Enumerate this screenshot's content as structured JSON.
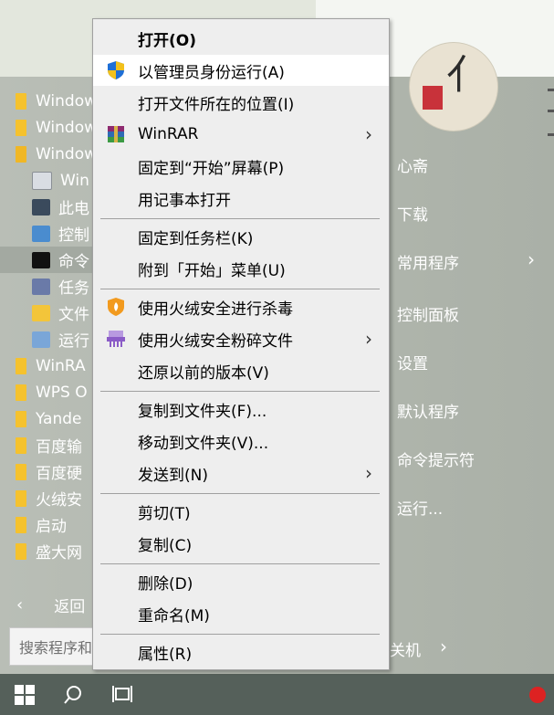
{
  "start_menu": {
    "apps": [
      {
        "label": "Window",
        "icon": "folder-icon"
      },
      {
        "label": "Window",
        "icon": "folder-icon"
      },
      {
        "label": "Window",
        "icon": "folder-open-icon"
      },
      {
        "label": "Win",
        "icon": "settings-app-icon"
      },
      {
        "label": "此电",
        "icon": "computer-icon"
      },
      {
        "label": "控制",
        "icon": "control-panel-icon"
      },
      {
        "label": "命令",
        "icon": "cmd-icon"
      },
      {
        "label": "任务",
        "icon": "task-scheduler-icon"
      },
      {
        "label": "文件",
        "icon": "file-explorer-icon"
      },
      {
        "label": "运行",
        "icon": "run-icon"
      },
      {
        "label": "WinRA",
        "icon": "folder-icon"
      },
      {
        "label": "WPS O",
        "icon": "folder-icon"
      },
      {
        "label": "Yande",
        "icon": "folder-icon"
      },
      {
        "label": "百度输",
        "icon": "folder-icon"
      },
      {
        "label": "百度硬",
        "icon": "folder-icon"
      },
      {
        "label": "火绒安",
        "icon": "folder-icon"
      },
      {
        "label": "启动",
        "icon": "folder-icon"
      },
      {
        "label": "盛大网",
        "icon": "folder-icon"
      }
    ],
    "back_label": "返回",
    "search_placeholder": "搜索程序和",
    "right_items": [
      {
        "label": "心斋"
      },
      {
        "label": "下载"
      },
      {
        "label": "常用程序",
        "submenu": true
      },
      {
        "label": "控制面板"
      },
      {
        "label": "设置"
      },
      {
        "label": "默认程序"
      },
      {
        "label": "命令提示符"
      },
      {
        "label": "运行..."
      }
    ],
    "power_label": "关机"
  },
  "context_menu": {
    "items": [
      {
        "label": "打开(O)",
        "bold": true
      },
      {
        "label": "以管理员身份运行(A)",
        "icon": "shield-icon",
        "hover": true
      },
      {
        "label": "打开文件所在的位置(I)"
      },
      {
        "label": "WinRAR",
        "icon": "winrar-icon",
        "submenu": true
      },
      {
        "label": "固定到“开始”屏幕(P)"
      },
      {
        "label": "用记事本打开"
      },
      {
        "label": "固定到任务栏(K)"
      },
      {
        "label": "附到「开始」菜单(U)"
      },
      {
        "label": "使用火绒安全进行杀毒",
        "icon": "huorong-shield-icon"
      },
      {
        "label": "使用火绒安全粉碎文件",
        "icon": "shredder-icon",
        "submenu": true
      },
      {
        "label": "还原以前的版本(V)"
      },
      {
        "label": "复制到文件夹(F)..."
      },
      {
        "label": "移动到文件夹(V)..."
      },
      {
        "label": "发送到(N)",
        "submenu": true
      },
      {
        "label": "剪切(T)"
      },
      {
        "label": "复制(C)"
      },
      {
        "label": "删除(D)"
      },
      {
        "label": "重命名(M)"
      },
      {
        "label": "属性(R)"
      }
    ]
  },
  "colors": {
    "accent_shield_blue": "#1f6fd6",
    "accent_shield_yellow": "#f2c11c",
    "huorong_orange": "#f29a1e",
    "shredder_purple": "#8b5cc7"
  }
}
